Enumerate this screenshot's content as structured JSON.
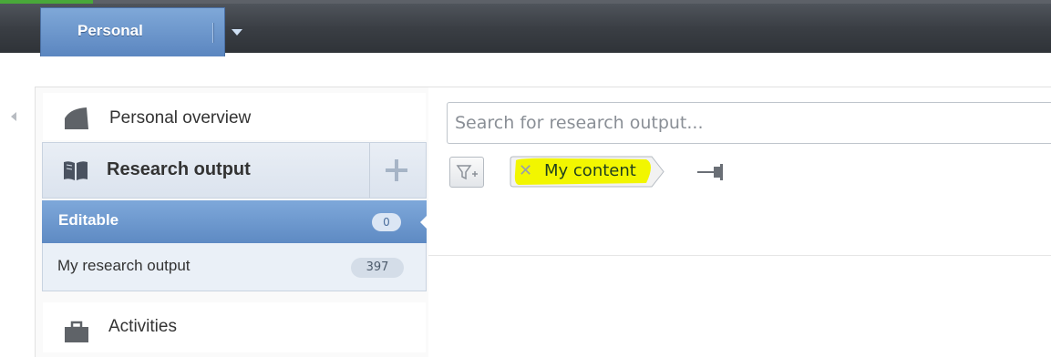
{
  "topbar": {
    "tab_label": "Personal"
  },
  "sidebar": {
    "overview_label": "Personal overview",
    "research_label": "Research output",
    "editable": {
      "label": "Editable",
      "count": "0"
    },
    "my_research": {
      "label": "My research output",
      "count": "397"
    },
    "activities_label": "Activities"
  },
  "main": {
    "search_placeholder": "Search for research output...",
    "filter_chip_label": "My content"
  },
  "colors": {
    "accent_blue": "#5e8ac3",
    "highlight_yellow": "#f4f400",
    "topbar": "#3a3e44"
  },
  "icons": [
    "chevron-down-icon",
    "collapse-left-icon",
    "overview-icon",
    "book-icon",
    "plus-icon",
    "briefcase-icon",
    "filter-add-icon",
    "close-icon",
    "pin-icon"
  ]
}
